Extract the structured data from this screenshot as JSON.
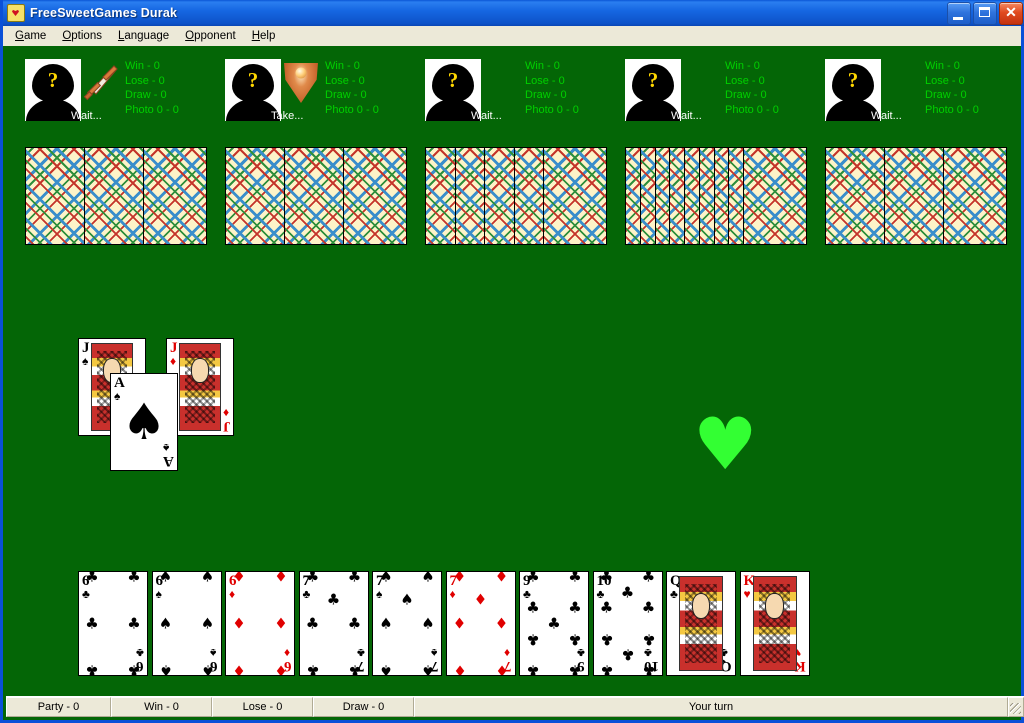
{
  "window": {
    "title": "FreeSweetGames Durak",
    "icon": "card-heart-icon",
    "minimize_label": "_",
    "maximize_label": "□",
    "close_label": "✕"
  },
  "menu": {
    "items": [
      {
        "label": "Game",
        "accel": "G"
      },
      {
        "label": "Options",
        "accel": "O"
      },
      {
        "label": "Language",
        "accel": "L"
      },
      {
        "label": "Opponent",
        "accel": "O"
      },
      {
        "label": "Help",
        "accel": "H"
      }
    ]
  },
  "colors": {
    "table_green": "#046606",
    "stats_green": "#00d000",
    "trump_green": "#33ff33",
    "titlebar_blue": "#0a56d6",
    "chrome": "#ece9d8",
    "card_back_base": "#fdf3c8"
  },
  "players": [
    {
      "avatar": "unknown-player-avatar",
      "role_icon": "sword-icon",
      "state_label": "Wait...",
      "win": "Win - 0",
      "lose": "Lose - 0",
      "draw": "Draw - 0",
      "photo": "Photo 0 - 0",
      "hand_count": 3
    },
    {
      "avatar": "unknown-player-avatar",
      "role_icon": "shield-icon",
      "state_label": "Take...",
      "win": "Win - 0",
      "lose": "Lose - 0",
      "draw": "Draw - 0",
      "photo": "Photo 0 - 0",
      "hand_count": 3
    },
    {
      "avatar": "unknown-player-avatar",
      "role_icon": "none",
      "state_label": "Wait...",
      "win": "Win - 0",
      "lose": "Lose - 0",
      "draw": "Draw - 0",
      "photo": "Photo 0 - 0",
      "hand_count": 5
    },
    {
      "avatar": "unknown-player-avatar",
      "role_icon": "none",
      "state_label": "Wait...",
      "win": "Win - 0",
      "lose": "Lose - 0",
      "draw": "Draw - 0",
      "photo": "Photo 0 - 0",
      "hand_count": 9
    },
    {
      "avatar": "unknown-player-avatar",
      "role_icon": "none",
      "state_label": "Wait...",
      "win": "Win - 0",
      "lose": "Lose - 0",
      "draw": "Draw - 0",
      "photo": "Photo 0 - 0",
      "hand_count": 3
    }
  ],
  "trump": {
    "suit": "hearts",
    "glyph": "♥"
  },
  "table_cards": [
    {
      "rank": "J",
      "suit": "♠",
      "color": "blk",
      "kind": "court"
    },
    {
      "rank": "J",
      "suit": "♦",
      "color": "red",
      "kind": "court"
    },
    {
      "rank": "A",
      "suit": "♠",
      "color": "blk",
      "kind": "ace"
    }
  ],
  "hand": [
    {
      "rank": "6",
      "suit": "♣",
      "color": "blk",
      "count": 6
    },
    {
      "rank": "6",
      "suit": "♠",
      "color": "blk",
      "count": 6
    },
    {
      "rank": "6",
      "suit": "♦",
      "color": "red",
      "count": 6
    },
    {
      "rank": "7",
      "suit": "♣",
      "color": "blk",
      "count": 7
    },
    {
      "rank": "7",
      "suit": "♠",
      "color": "blk",
      "count": 7
    },
    {
      "rank": "7",
      "suit": "♦",
      "color": "red",
      "count": 7
    },
    {
      "rank": "9",
      "suit": "♣",
      "color": "blk",
      "count": 9
    },
    {
      "rank": "10",
      "suit": "♣",
      "color": "blk",
      "count": 10
    },
    {
      "rank": "Q",
      "suit": "♣",
      "color": "blk",
      "count": 0
    },
    {
      "rank": "K",
      "suit": "♥",
      "color": "red",
      "count": 0
    }
  ],
  "statusbar": {
    "party": "Party - 0",
    "win": "Win - 0",
    "lose": "Lose - 0",
    "draw": "Draw - 0",
    "turn": "Your turn"
  }
}
